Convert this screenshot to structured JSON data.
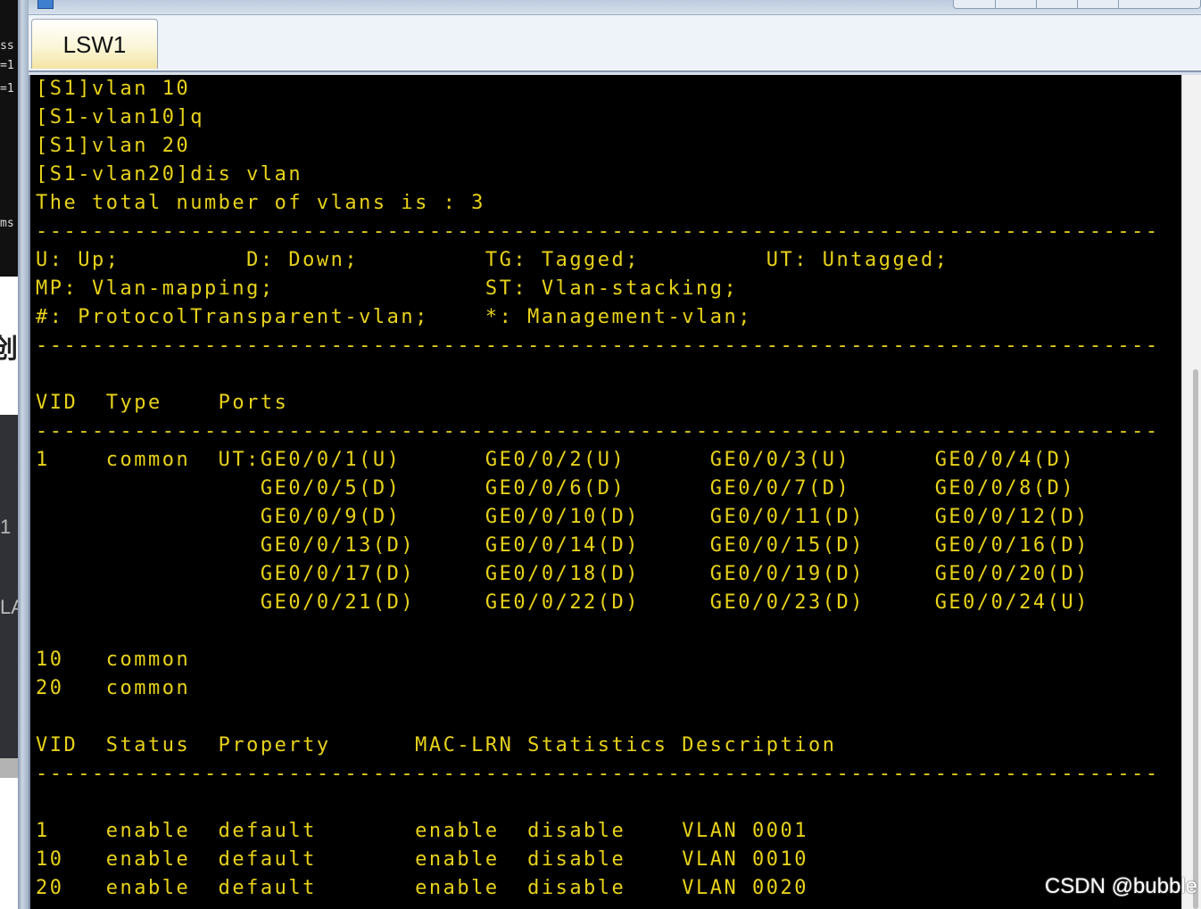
{
  "window": {
    "tab_label": "LSW1"
  },
  "console": {
    "lines": [
      "[S1]vlan 10",
      "[S1-vlan10]q",
      "[S1]vlan 20",
      "[S1-vlan20]dis vlan",
      "The total number of vlans is : 3",
      "--------------------------------------------------------------------------------",
      "U: Up;         D: Down;         TG: Tagged;         UT: Untagged;",
      "MP: Vlan-mapping;               ST: Vlan-stacking;",
      "#: ProtocolTransparent-vlan;    *: Management-vlan;",
      "--------------------------------------------------------------------------------",
      "",
      "VID  Type    Ports",
      "--------------------------------------------------------------------------------",
      "1    common  UT:GE0/0/1(U)      GE0/0/2(U)      GE0/0/3(U)      GE0/0/4(D)",
      "                GE0/0/5(D)      GE0/0/6(D)      GE0/0/7(D)      GE0/0/8(D)",
      "                GE0/0/9(D)      GE0/0/10(D)     GE0/0/11(D)     GE0/0/12(D)",
      "                GE0/0/13(D)     GE0/0/14(D)     GE0/0/15(D)     GE0/0/16(D)",
      "                GE0/0/17(D)     GE0/0/18(D)     GE0/0/19(D)     GE0/0/20(D)",
      "                GE0/0/21(D)     GE0/0/22(D)     GE0/0/23(D)     GE0/0/24(U)",
      "",
      "10   common",
      "20   common",
      "",
      "VID  Status  Property      MAC-LRN Statistics Description",
      "--------------------------------------------------------------------------------",
      "",
      "1    enable  default       enable  disable    VLAN 0001",
      "10   enable  default       enable  disable    VLAN 0010",
      "20   enable  default       enable  disable    VLAN 0020"
    ]
  },
  "background_window": {
    "fragments": [
      "ss",
      "=1",
      "=1",
      "ms",
      "创",
      "1",
      "LA"
    ]
  },
  "watermark": "CSDN @bubble",
  "colors": {
    "console_bg": "#000000",
    "console_text": "#e8d21a",
    "tab_active": "#f3e4a4"
  }
}
